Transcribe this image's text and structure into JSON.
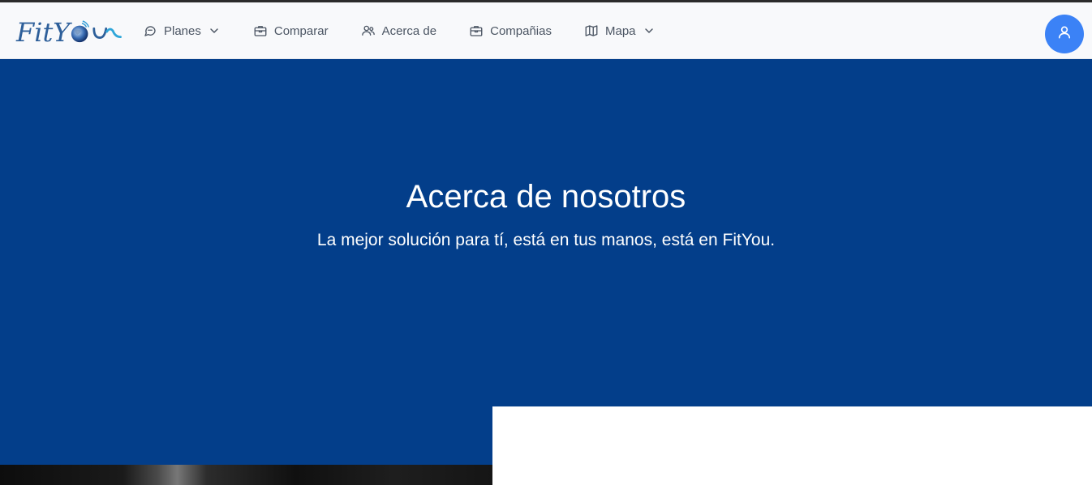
{
  "brand": {
    "name": "FitYou"
  },
  "nav": {
    "items": [
      {
        "label": "Planes",
        "icon": "chat-bubble-icon",
        "has_dropdown": true
      },
      {
        "label": "Comparar",
        "icon": "briefcase-icon",
        "has_dropdown": false
      },
      {
        "label": "Acerca de",
        "icon": "users-icon",
        "has_dropdown": false
      },
      {
        "label": "Compañias",
        "icon": "briefcase-icon",
        "has_dropdown": false
      },
      {
        "label": "Mapa",
        "icon": "map-icon",
        "has_dropdown": true
      }
    ]
  },
  "user_button": {
    "icon": "user-icon"
  },
  "hero": {
    "title": "Acerca de nosotros",
    "subtitle": "La mejor solución para tí, está en tus manos, está en FitYou."
  },
  "colors": {
    "hero_background": "#033e8a",
    "navbar_background": "#f8f9fb",
    "avatar_button": "#3b82f6",
    "nav_text": "#4b5563"
  }
}
